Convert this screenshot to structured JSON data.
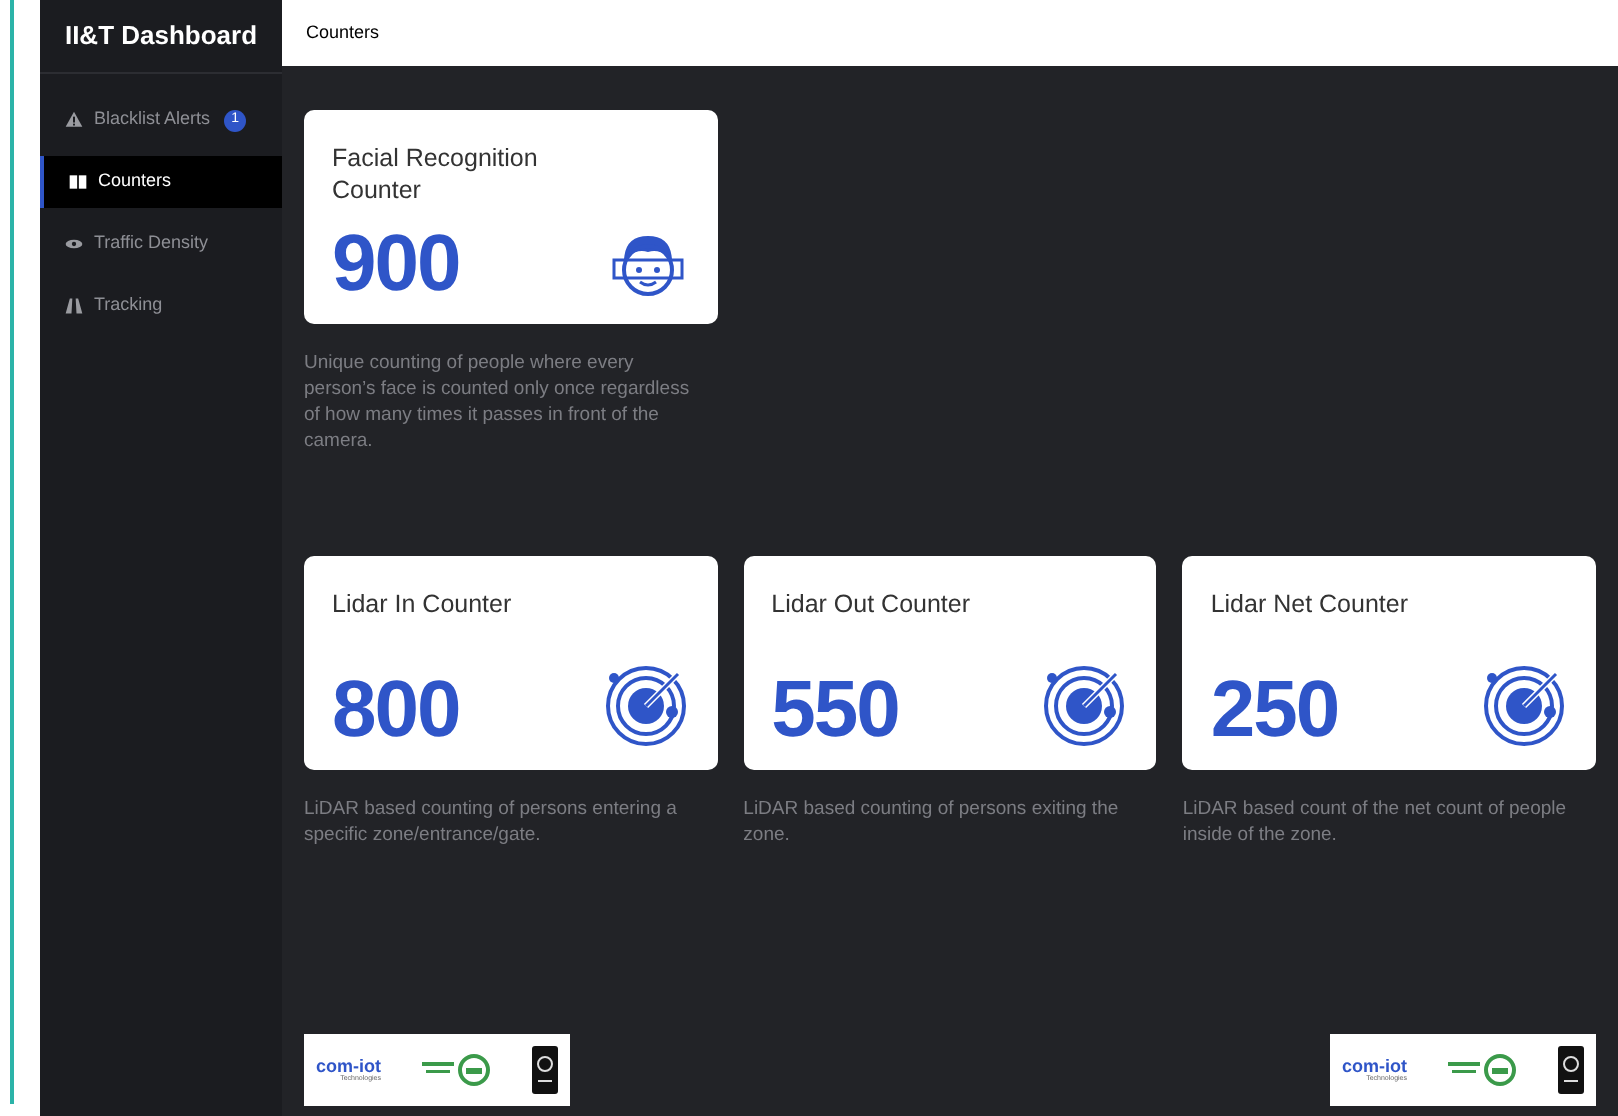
{
  "sidebar": {
    "title": "II&T Dashboard",
    "items": [
      {
        "label": "Blacklist Alerts",
        "kind": "warning",
        "badge": "1",
        "selected": false
      },
      {
        "label": "Counters",
        "kind": "columns",
        "selected": true
      },
      {
        "label": "Traffic Density",
        "kind": "eye",
        "selected": false
      },
      {
        "label": "Tracking",
        "kind": "road",
        "selected": false
      }
    ]
  },
  "header": {
    "title": "Counters"
  },
  "counter_rows": [
    [
      {
        "title": "Facial Recognition Counter",
        "value": "900",
        "kind": "face",
        "description": "Unique counting of people where every person’s face is counted only once regardless of how many times it passes in front of the camera."
      }
    ],
    [
      {
        "title": "Lidar In Counter",
        "value": "800",
        "kind": "radar",
        "description": "LiDAR based counting of persons entering a specific zone/entrance/gate."
      },
      {
        "title": "Lidar Out Counter",
        "value": "550",
        "kind": "radar",
        "description": "LiDAR based counting of persons exiting the zone."
      },
      {
        "title": "Lidar Net Counter",
        "value": "250",
        "kind": "radar",
        "description": "LiDAR based count of the net count of people inside of the zone."
      }
    ]
  ],
  "footer_logos": [
    {
      "brand": "com-iot",
      "tagline": "Technologies"
    },
    {
      "brand": "com-iot",
      "tagline": "Technologies"
    }
  ]
}
